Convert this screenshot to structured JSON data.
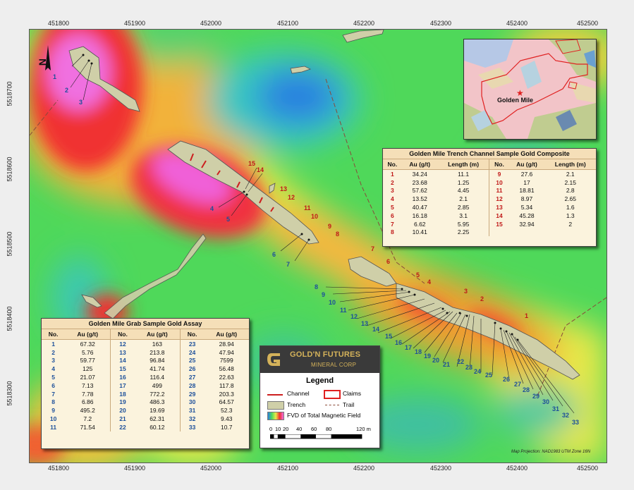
{
  "axes": {
    "x_ticks": [
      "451800",
      "451900",
      "452000",
      "452100",
      "452200",
      "452300",
      "452400",
      "452500"
    ],
    "y_ticks": [
      "5518700",
      "5518600",
      "5518500",
      "5518400",
      "5518300"
    ]
  },
  "channel_labels": [
    "1",
    "2",
    "3",
    "4",
    "5",
    "6",
    "7",
    "8",
    "9",
    "10",
    "11",
    "12",
    "13",
    "14",
    "15"
  ],
  "grab_labels": [
    "1",
    "2",
    "3",
    "4",
    "5",
    "6",
    "7",
    "8",
    "9",
    "10",
    "11",
    "12",
    "13",
    "14",
    "15",
    "16",
    "17",
    "18",
    "19",
    "20",
    "21",
    "22",
    "23",
    "24",
    "25",
    "26",
    "27",
    "28",
    "29",
    "30",
    "31",
    "32",
    "33"
  ],
  "trench_table": {
    "title": "Golden Mile Trench Channel Sample Gold Composite",
    "headers": [
      "No.",
      "Au (g/t)",
      "Length (m)",
      "No.",
      "Au (g/t)",
      "Length (m)"
    ],
    "rows": [
      [
        "1",
        "34.24",
        "11.1",
        "9",
        "27.6",
        "2.1"
      ],
      [
        "2",
        "23.68",
        "1.25",
        "10",
        "17",
        "2.15"
      ],
      [
        "3",
        "57.62",
        "4.45",
        "11",
        "18.81",
        "2.8"
      ],
      [
        "4",
        "13.52",
        "2.1",
        "12",
        "8.97",
        "2.65"
      ],
      [
        "5",
        "40.47",
        "2.85",
        "13",
        "5.34",
        "1.6"
      ],
      [
        "6",
        "16.18",
        "3.1",
        "14",
        "45.28",
        "1.3"
      ],
      [
        "7",
        "6.62",
        "5.95",
        "15",
        "32.94",
        "2"
      ],
      [
        "8",
        "10.41",
        "2.25",
        "",
        "",
        ""
      ]
    ]
  },
  "grab_table": {
    "title": "Golden Mile Grab Sample Gold Assay",
    "headers": [
      "No.",
      "Au (g/t)",
      "No.",
      "Au (g/t)",
      "No.",
      "Au (g/t)"
    ],
    "rows": [
      [
        "1",
        "67.32",
        "12",
        "163",
        "23",
        "28.94"
      ],
      [
        "2",
        "5.76",
        "13",
        "213.8",
        "24",
        "47.94"
      ],
      [
        "3",
        "59.77",
        "14",
        "96.84",
        "25",
        "7599"
      ],
      [
        "4",
        "125",
        "15",
        "41.74",
        "26",
        "56.48"
      ],
      [
        "5",
        "21.07",
        "16",
        "116.4",
        "27",
        "22.63"
      ],
      [
        "6",
        "7.13",
        "17",
        "499",
        "28",
        "117.8"
      ],
      [
        "7",
        "7.78",
        "18",
        "772.2",
        "29",
        "203.3"
      ],
      [
        "8",
        "6.86",
        "19",
        "486.3",
        "30",
        "64.57"
      ],
      [
        "9",
        "495.2",
        "20",
        "19.69",
        "31",
        "52.3"
      ],
      [
        "10",
        "7.2",
        "21",
        "62.31",
        "32",
        "9.43"
      ],
      [
        "11",
        "71.54",
        "22",
        "60.12",
        "33",
        "10.7"
      ]
    ]
  },
  "logo": {
    "name": "GOLD'N FUTURES",
    "sub": "MINERAL CORP"
  },
  "legend": {
    "title": "Legend",
    "channel": "Channel",
    "claims": "Claims",
    "trench": "Trench",
    "trail": "Trail",
    "fvd": "FVD of Total Magnetic Field",
    "scale": [
      "0",
      "10",
      "20",
      "40",
      "60",
      "80",
      "120 m"
    ]
  },
  "inset": {
    "label": "Golden Mile"
  },
  "north_label": "N",
  "projection": "Map Projection: NAD1983 UTM Zone 16N",
  "colors": {
    "channel": "#cc1f1f",
    "claims": "#e02020",
    "trench": "#cfcfa8",
    "trail": "#8a4a3a",
    "frame": "#eeeeee"
  }
}
